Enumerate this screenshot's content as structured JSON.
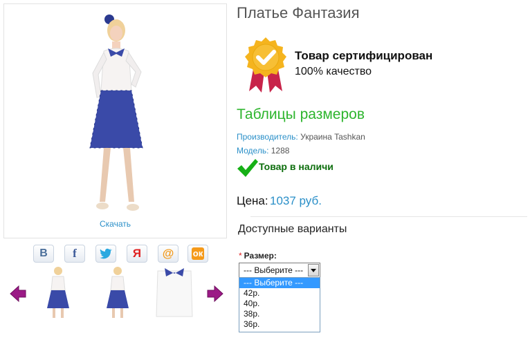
{
  "product": {
    "title": "Платье Фантазия",
    "download_link": "Скачать"
  },
  "certificate": {
    "title": "Товар сертифицирован",
    "subtitle": "100% качество",
    "colors": {
      "badge": "#f5b41e",
      "ribbon": "#c8244a"
    }
  },
  "size_table_link": "Таблицы размеров",
  "meta": {
    "manufacturer_label": "Производитель:",
    "manufacturer_value": "Украина Tashkan",
    "model_label": "Модель:",
    "model_value": "1288"
  },
  "stock_status": "Товар в наличи",
  "price": {
    "label": "Цена:",
    "value": "1037 руб."
  },
  "variants": {
    "heading": "Доступные варианты",
    "size_label": "Размер:",
    "required_mark": "*",
    "selected": "--- Выберите ---",
    "options": [
      "--- Выберите ---",
      "42р.",
      "40р.",
      "38р.",
      "36р."
    ]
  },
  "social": [
    "vk-icon",
    "facebook-icon",
    "twitter-icon",
    "yandex-icon",
    "mail-icon",
    "odnoklassniki-icon"
  ],
  "colors": {
    "accent_blue": "#2a8fc8",
    "green": "#2db52d",
    "arrow": "#9b1a86"
  }
}
